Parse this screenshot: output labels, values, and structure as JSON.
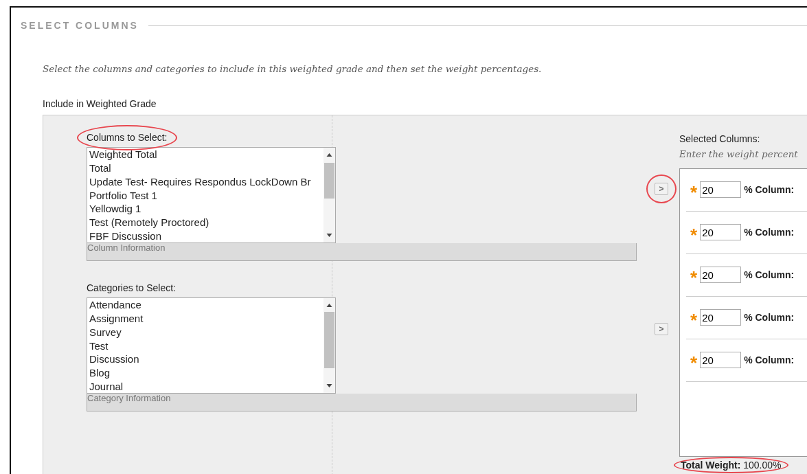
{
  "section": {
    "title": "SELECT COLUMNS"
  },
  "instructions": "Select the columns and categories to include in this weighted grade and then set the weight percentages.",
  "include_label": "Include in Weighted Grade",
  "columns_list": {
    "label": "Columns to Select:",
    "highlighted": true,
    "info": "Column Information",
    "items": [
      "Weighted Total",
      "Total",
      "Update Test- Requires Respondus LockDown Br",
      "Portfolio Test 1",
      "Yellowdig 1",
      "Test (Remotely Proctored)",
      "FBF Discussion"
    ],
    "move_button": {
      "label": ">",
      "highlighted": true
    }
  },
  "categories_list": {
    "label": "Categories to Select:",
    "highlighted": false,
    "info": "Category Information",
    "items": [
      "Attendance",
      "Assignment",
      "Survey",
      "Test",
      "Discussion",
      "Blog",
      "Journal"
    ],
    "move_button": {
      "label": ">",
      "highlighted": false
    }
  },
  "selected": {
    "label": "Selected Columns:",
    "hint": "Enter the weight percent",
    "rows": [
      {
        "required": "*",
        "value": "20",
        "label": "% Column:"
      },
      {
        "required": "*",
        "value": "20",
        "label": "% Column:"
      },
      {
        "required": "*",
        "value": "20",
        "label": "% Column:"
      },
      {
        "required": "*",
        "value": "20",
        "label": "% Column:"
      },
      {
        "required": "*",
        "value": "20",
        "label": "% Column:"
      }
    ],
    "total": {
      "text": "**Total Weight:** 100.00%",
      "highlighted": true
    }
  }
}
